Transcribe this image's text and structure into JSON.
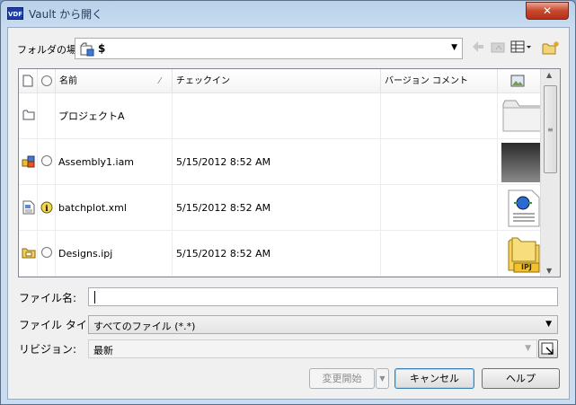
{
  "window": {
    "title": "Vault から開く",
    "close": "✕"
  },
  "app_icon": "VDF",
  "folder": {
    "label": "フォルダの場所:",
    "value": "$"
  },
  "toolbar": [
    "back-icon",
    "up-folder-icon",
    "view-menu-icon",
    "new-folder-icon"
  ],
  "columns": {
    "name": "名前",
    "checkin": "チェックイン",
    "comment": "バージョン コメント"
  },
  "files": [
    {
      "name": "プロジェクトA",
      "checkin": "",
      "comment": "",
      "icon": "folder-icon",
      "status": "",
      "thumb": "folder-thumb"
    },
    {
      "name": "Assembly1.iam",
      "checkin": "5/15/2012 8:52 AM",
      "comment": "",
      "icon": "assembly-icon",
      "status": "circle",
      "thumb": "dark-thumb"
    },
    {
      "name": "batchplot.xml",
      "checkin": "5/15/2012 8:52 AM",
      "comment": "",
      "icon": "xml-doc-icon",
      "status": "info",
      "thumb": "xml-thumb"
    },
    {
      "name": "Designs.ipj",
      "checkin": "5/15/2012 8:52 AM",
      "comment": "",
      "icon": "project-icon",
      "status": "circle",
      "thumb": "ipj-thumb"
    }
  ],
  "ipj_label": "IPJ",
  "form": {
    "filename_label": "ファイル名:",
    "filename_value": "",
    "filetype_label": "ファイル タイプ:",
    "filetype_value": "すべてのファイル (*.*)",
    "revision_label": "リビジョン:",
    "revision_value": "最新"
  },
  "buttons": {
    "checkout": "変更開始",
    "cancel": "キャンセル",
    "help": "ヘルプ"
  }
}
